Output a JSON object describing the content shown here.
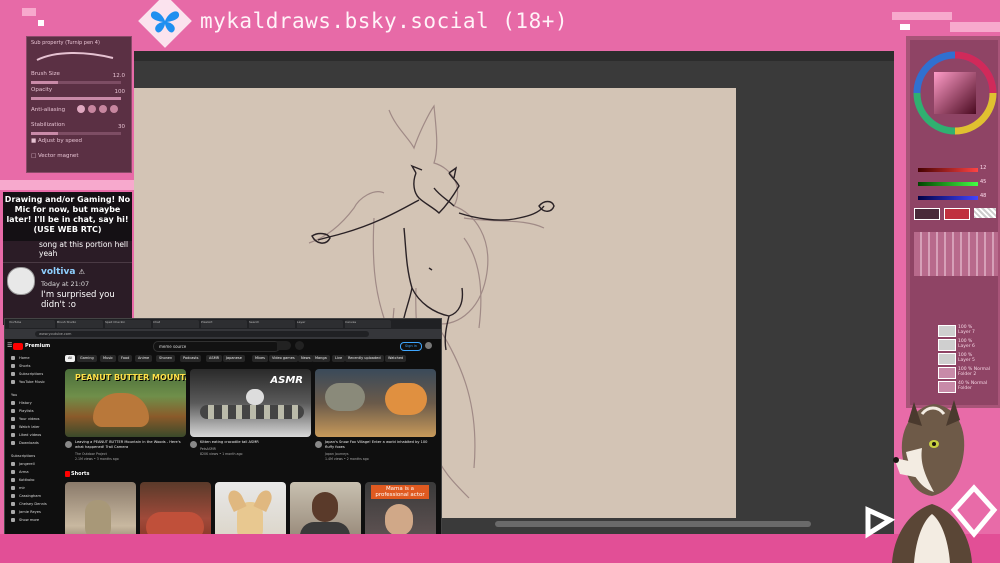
{
  "stream": {
    "title": "mykaldraws.bsky.social (18+)",
    "logo_icon": "butterfly-icon",
    "accent_color": "#e76aa7"
  },
  "tool_panel": {
    "header": "Sub property (Turnip pen 4)",
    "brush_size_label": "Brush Size",
    "brush_size_value": "12.0",
    "opacity_label": "Opacity",
    "opacity_value": "100",
    "opacity_fraction": 1.0,
    "antialias_label": "Anti-aliasing",
    "stabilization_label": "Stabilization",
    "stabilization_value": "30",
    "stabilization_fraction": 0.3,
    "adjust_by_speed_label": "Adjust by speed",
    "vector_magnet_label": "Vector magnet"
  },
  "chat": {
    "header": "Drawing and/or Gaming! No Mic for now, but maybe later! I'll be in chat, say hi! (USE WEB RTC)",
    "previous_message": "song at this portion hell yeah",
    "message": {
      "user": "voltiva",
      "time": "Today at 21:07",
      "text": "I'm surprised you didn't :o"
    }
  },
  "youtube": {
    "tabs": [
      "YouTube",
      "Brush Studio",
      "Spell Checkin",
      "Chat",
      "PixelArt",
      "Search",
      "Layer",
      "Canvas"
    ],
    "address": "www.youtube.com",
    "logo_text": "Premium",
    "search_value": "meme source",
    "signin_label": "Sign in",
    "sidebar": [
      {
        "label": "Home"
      },
      {
        "label": "Shorts"
      },
      {
        "label": "Subscriptions"
      },
      {
        "label": "YouTube Music"
      },
      {
        "label": "You"
      },
      {
        "label": "History"
      },
      {
        "label": "Playlists"
      },
      {
        "label": "Your videos"
      },
      {
        "label": "Watch later"
      },
      {
        "label": "Liked videos"
      },
      {
        "label": "Downloads"
      },
      {
        "label": "Subscriptions"
      },
      {
        "label": "jangerell"
      },
      {
        "label": "Arma"
      },
      {
        "label": "Kottkoko"
      },
      {
        "label": "mir"
      },
      {
        "label": "Cassingham"
      },
      {
        "label": "Chelsey Dennis"
      },
      {
        "label": "Jamie Reyes"
      },
      {
        "label": "Show more"
      }
    ],
    "chips": [
      "All",
      "Gaming",
      "Music",
      "Food",
      "Anime",
      "Shonen",
      "Podcasts",
      "ASMR",
      "Japanese",
      "Mixes",
      "Video games",
      "News",
      "Manga",
      "Live",
      "Recently uploaded",
      "Watched"
    ],
    "videos": [
      {
        "title": "Leaving a PEANUT BUTTER Mountain in the Woods - Here's what happened! Trail Camera",
        "channel": "The Outdoor Project",
        "meta": "2.1M views • 3 months ago",
        "thumb_text": "PEANUT BUTTER MOUNTAIN"
      },
      {
        "title": "Kitten eating crocodile tail ASMR",
        "channel": "PetsASMR",
        "meta": "820K views • 1 month ago",
        "thumb_text": "ASMR"
      },
      {
        "title": "Japan's Snow Fox Village! Enter a world inhabited by 100 fluffy foxes",
        "channel": "Japan Journeys",
        "meta": "1.4M views • 2 months ago",
        "thumb_text": ""
      }
    ],
    "shorts_label": "Shorts",
    "shorts": [
      {
        "caption": ""
      },
      {
        "caption": ""
      },
      {
        "caption": ""
      },
      {
        "caption": ""
      },
      {
        "caption": "Mama is a professional actor"
      }
    ]
  },
  "layers": {
    "items": [
      {
        "opacity": "100 %",
        "name": "Layer 7"
      },
      {
        "opacity": "100 %",
        "name": "Layer 6"
      },
      {
        "opacity": "100 %",
        "name": "Layer 5"
      },
      {
        "opacity": "100 % Normal",
        "name": "Folder 2"
      },
      {
        "opacity": "40 % Normal",
        "name": "Folder"
      },
      {
        "opacity": "100 %",
        "name": "Layer 1"
      },
      {
        "opacity": "100 %",
        "name": "Paper"
      }
    ],
    "color_values": [
      "12",
      "45",
      "48"
    ],
    "main_color": "#c0303f"
  }
}
